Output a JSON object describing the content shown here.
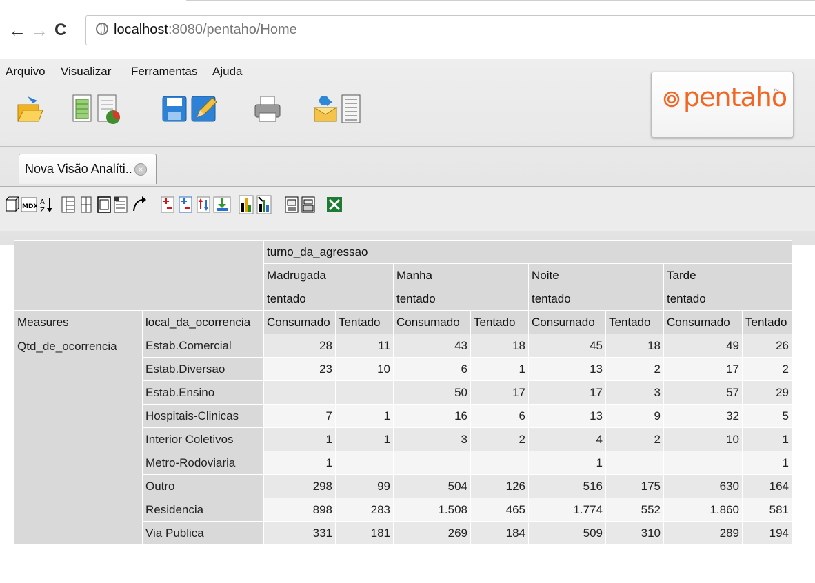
{
  "browser": {
    "url_host": "localhost",
    "url_rest": ":8080/pentaho/Home"
  },
  "menu": {
    "items": [
      "Arquivo",
      "Visualizar",
      "Ferramentas",
      "Ajuda"
    ]
  },
  "toolbar_main": {
    "icons": [
      "open-folder-icon",
      "new-report-icon",
      "new-analysis-icon",
      "save-icon",
      "edit-icon",
      "print-icon",
      "publish-icon",
      "properties-icon"
    ]
  },
  "logo": {
    "text": "pentaho",
    "tm": "™",
    "color": "#f26522"
  },
  "tab": {
    "label": "Nova Visão Analíti..",
    "close": "×"
  },
  "analysis_toolbar": {
    "icons": [
      "cube-icon",
      "mdx-icon",
      "sort-icon",
      "layout-icon",
      "hierarchy-icon",
      "table-icon",
      "properties-icon",
      "drill-icon",
      "expand-icon",
      "collapse-icon",
      "swap-icon",
      "drill-through-icon",
      "chart-icon",
      "chart-config-icon",
      "export-pdf-icon",
      "print-icon",
      "excel-icon"
    ]
  },
  "pivot": {
    "column_dimension": "turno_da_agressao",
    "turnos": [
      "Madrugada",
      "Manha",
      "Noite",
      "Tarde"
    ],
    "sub_level": "tentado",
    "measures_label": "Measures",
    "row_dimension": "local_da_ocorrencia",
    "leaf_columns": [
      "Consumado",
      "Tentado"
    ],
    "measure": "Qtd_de_ocorrencia",
    "rows": [
      {
        "label": "Estab.Comercial",
        "values": [
          "28",
          "11",
          "43",
          "18",
          "45",
          "18",
          "49",
          "26"
        ]
      },
      {
        "label": "Estab.Diversao",
        "values": [
          "23",
          "10",
          "6",
          "1",
          "13",
          "2",
          "17",
          "2"
        ]
      },
      {
        "label": "Estab.Ensino",
        "values": [
          "",
          "",
          "50",
          "17",
          "17",
          "3",
          "57",
          "29"
        ]
      },
      {
        "label": "Hospitais-Clinicas",
        "values": [
          "7",
          "1",
          "16",
          "6",
          "13",
          "9",
          "32",
          "5"
        ]
      },
      {
        "label": "Interior Coletivos",
        "values": [
          "1",
          "1",
          "3",
          "2",
          "4",
          "2",
          "10",
          "1"
        ]
      },
      {
        "label": "Metro-Rodoviaria",
        "values": [
          "1",
          "",
          "",
          "",
          "1",
          "",
          "",
          "1"
        ]
      },
      {
        "label": "Outro",
        "values": [
          "298",
          "99",
          "504",
          "126",
          "516",
          "175",
          "630",
          "164"
        ]
      },
      {
        "label": "Residencia",
        "values": [
          "898",
          "283",
          "1.508",
          "465",
          "1.774",
          "552",
          "1.860",
          "581"
        ]
      },
      {
        "label": "Via Publica",
        "values": [
          "331",
          "181",
          "269",
          "184",
          "509",
          "310",
          "289",
          "194"
        ]
      }
    ]
  }
}
